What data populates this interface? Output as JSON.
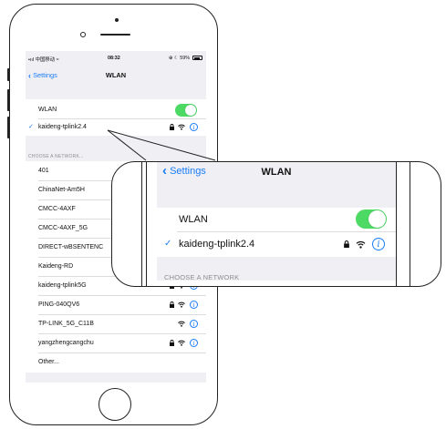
{
  "status_bar": {
    "carrier": "•ııl 中国移动 ≈",
    "time": "08:32",
    "right": "⊕ ☾ 59%"
  },
  "nav": {
    "back_label": "Settings",
    "title": "WLAN"
  },
  "wlan": {
    "label": "WLAN",
    "enabled": true,
    "connected_network": "kaideng-tplink2.4"
  },
  "section_header": "CHOOSE A NETWORK...",
  "networks": [
    {
      "name": "401",
      "locked": false,
      "info": false
    },
    {
      "name": "ChinaNet-Am5H",
      "locked": false,
      "info": false
    },
    {
      "name": "CMCC-4AXF",
      "locked": false,
      "info": false
    },
    {
      "name": "CMCC-4AXF_5G",
      "locked": false,
      "info": false
    },
    {
      "name": "DIRECT-wBSENTENC",
      "locked": false,
      "info": false
    },
    {
      "name": "Kaideng-RD",
      "locked": false,
      "info": false
    },
    {
      "name": "kaideng-tplink5G",
      "locked": true,
      "info": true
    },
    {
      "name": "PING-040QV6",
      "locked": true,
      "info": true
    },
    {
      "name": "TP-LINK_5G_C11B",
      "locked": false,
      "info": true
    },
    {
      "name": "yangzhengcangchu",
      "locked": true,
      "info": true
    },
    {
      "name": "Other...",
      "locked": false,
      "info": false
    }
  ],
  "zoom": {
    "back_label": "Settings",
    "title": "WLAN",
    "wlan_label": "WLAN",
    "connected_network": "kaideng-tplink2.4",
    "section_header": "CHOOSE A NETWORK"
  },
  "colors": {
    "accent": "#1a7cf5",
    "toggle_on": "#4cd964",
    "background": "#efeff4"
  },
  "icons": {
    "lock": "lock-icon",
    "wifi": "wifi-icon",
    "info": "info-icon",
    "check": "checkmark-icon",
    "back": "chevron-left-icon"
  }
}
